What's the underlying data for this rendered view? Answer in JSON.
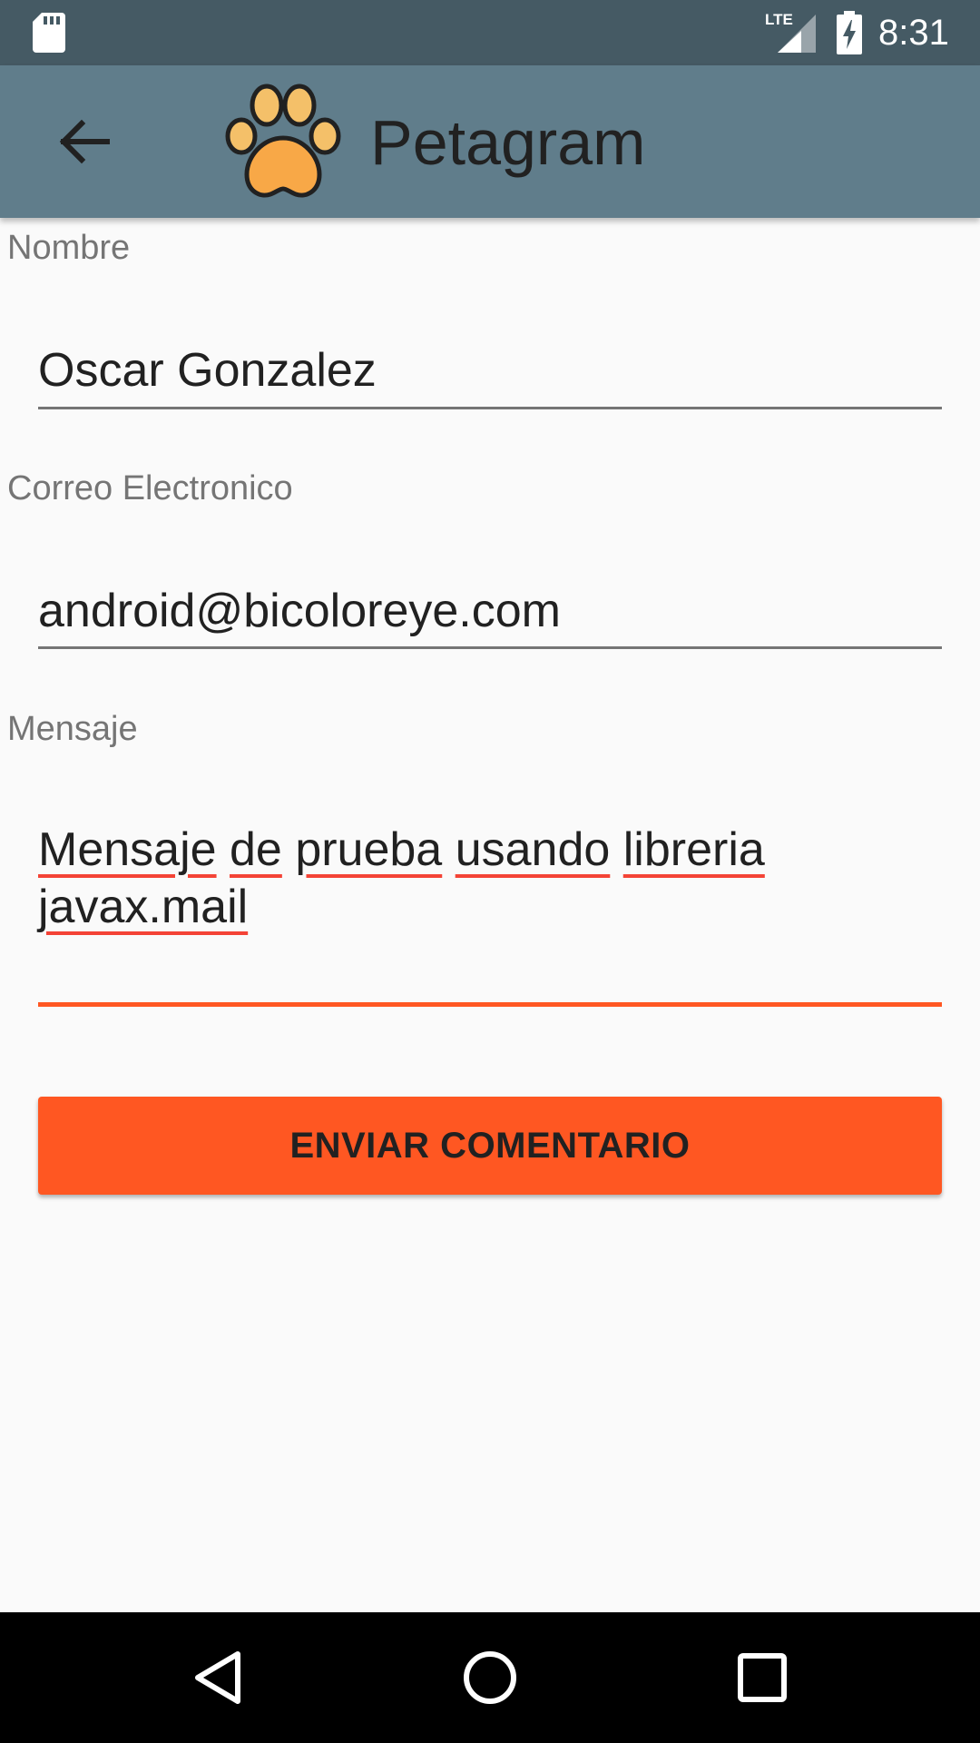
{
  "status_bar": {
    "time": "8:31",
    "network_label": "LTE",
    "icons": [
      "sd-card-icon",
      "lte-signal-icon",
      "battery-charging-icon"
    ]
  },
  "app_bar": {
    "title": "Petagram",
    "back_icon": "arrow-back-icon",
    "logo_icon": "paw-icon"
  },
  "form": {
    "name": {
      "label": "Nombre",
      "value": "Oscar Gonzalez"
    },
    "email": {
      "label": "Correo Electronico",
      "value": "android@bicoloreye.com"
    },
    "message": {
      "label": "Mensaje",
      "line1_words": [
        "Mensaje",
        "de",
        "prueba",
        "usando",
        "libreria"
      ],
      "line2_words": [
        "javax.mail"
      ]
    },
    "submit_label": "ENVIAR COMENTARIO"
  },
  "nav_bar": {
    "icons": [
      "back-triangle-icon",
      "home-circle-icon",
      "recents-square-icon"
    ]
  },
  "colors": {
    "status_bar": "#455a64",
    "app_bar": "#607d8b",
    "accent": "#ff5722",
    "background": "#fafafa",
    "spellcheck": "#f44336"
  }
}
